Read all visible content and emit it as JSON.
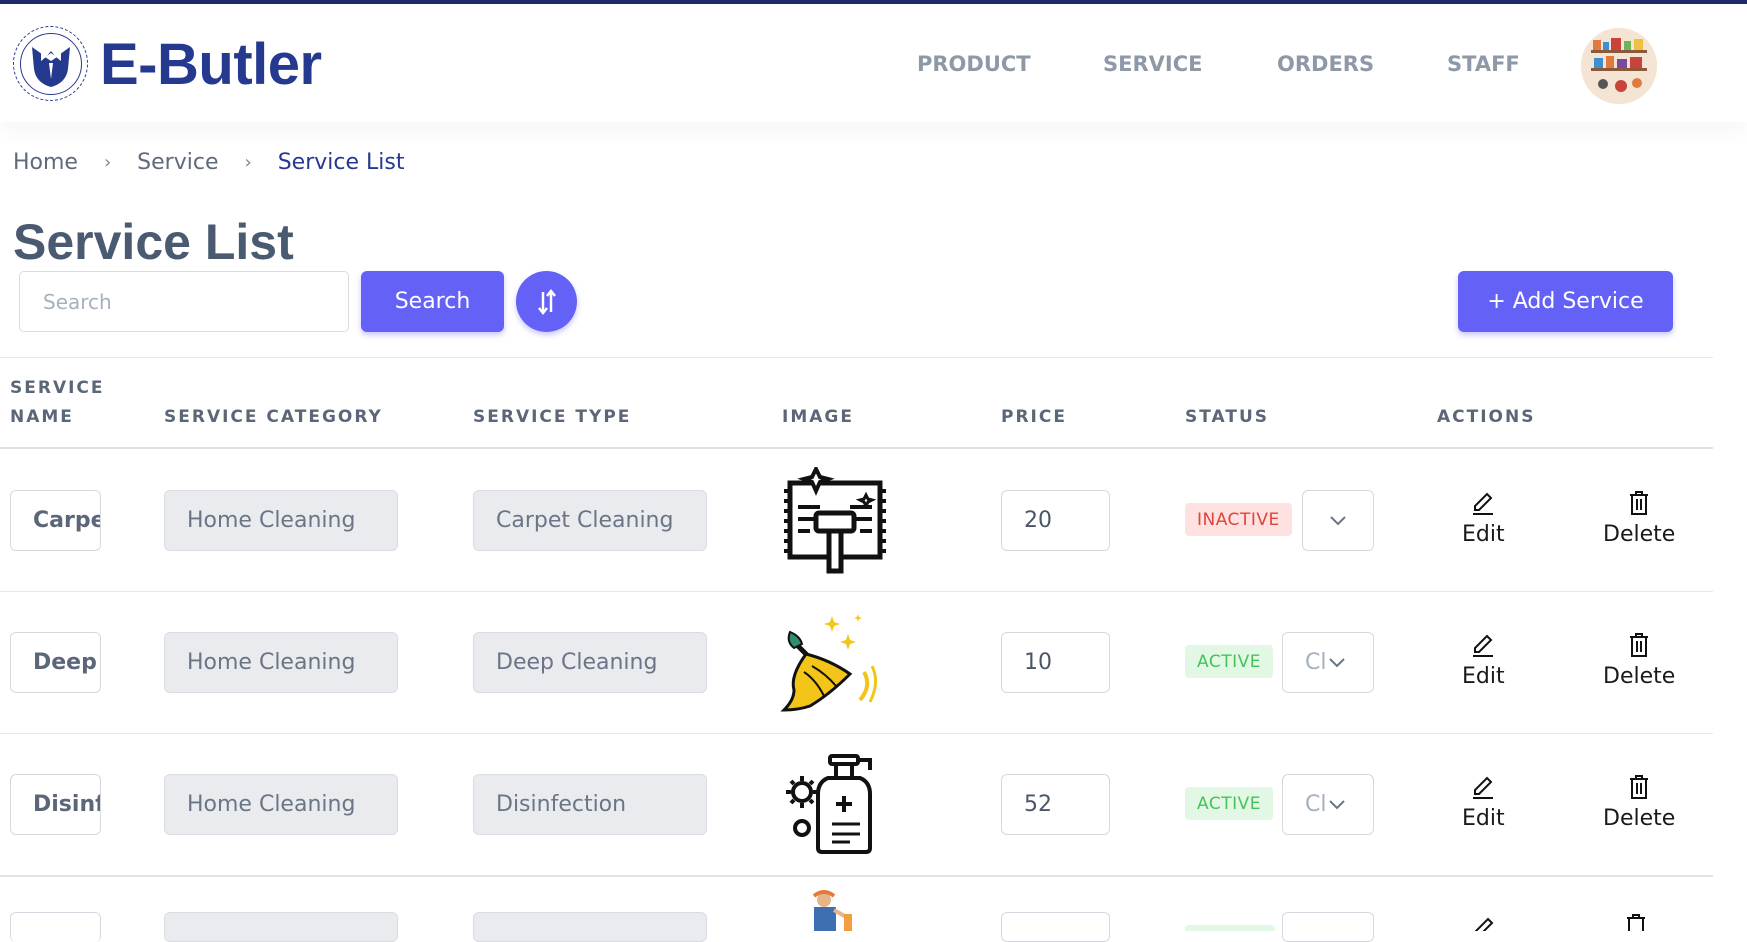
{
  "app": {
    "brand": "E-Butler",
    "accent_color": "#6461f7",
    "brand_color": "#253a8f"
  },
  "nav": {
    "links": [
      "PRODUCT",
      "SERVICE",
      "ORDERS",
      "STAFF"
    ],
    "avatar_icon": "kitchen-shelves-avatar"
  },
  "breadcrumb": {
    "items": [
      "Home",
      "Service",
      "Service List"
    ]
  },
  "page": {
    "title": "Service List"
  },
  "toolbar": {
    "search_placeholder": "Search",
    "search_button": "Search",
    "sort_icon": "sort-arrows-icon",
    "add_button": "+ Add Service"
  },
  "table": {
    "headers": {
      "service_name_1": "SERVICE",
      "service_name_2": "NAME",
      "service_category": "SERVICE CATEGORY",
      "service_type": "SERVICE TYPE",
      "image": "IMAGE",
      "price": "PRICE",
      "status": "STATUS",
      "actions": "ACTIONS"
    },
    "rows": [
      {
        "name": "Carpet Cleaning",
        "category": "Home Cleaning",
        "type": "Carpet Cleaning",
        "image_icon": "carpet-vacuum-icon",
        "price": "20",
        "status": "INACTIVE",
        "status_select": "",
        "edit": "Edit",
        "delete": "Delete"
      },
      {
        "name": "Deep Cleaning",
        "category": "Home Cleaning",
        "type": "Deep Cleaning",
        "image_icon": "sparkle-broom-icon",
        "price": "10",
        "status": "ACTIVE",
        "status_select": "Cl",
        "edit": "Edit",
        "delete": "Delete"
      },
      {
        "name": "Disinfection",
        "category": "Home Cleaning",
        "type": "Disinfection",
        "image_icon": "sanitizer-bottle-icon",
        "price": "52",
        "status": "ACTIVE",
        "status_select": "Cl",
        "edit": "Edit",
        "delete": "Delete"
      }
    ]
  },
  "status_colors": {
    "inactive_bg": "#fde2e1",
    "inactive_text": "#e0443a",
    "active_bg": "#e3f7e5",
    "active_text": "#45c35a"
  }
}
